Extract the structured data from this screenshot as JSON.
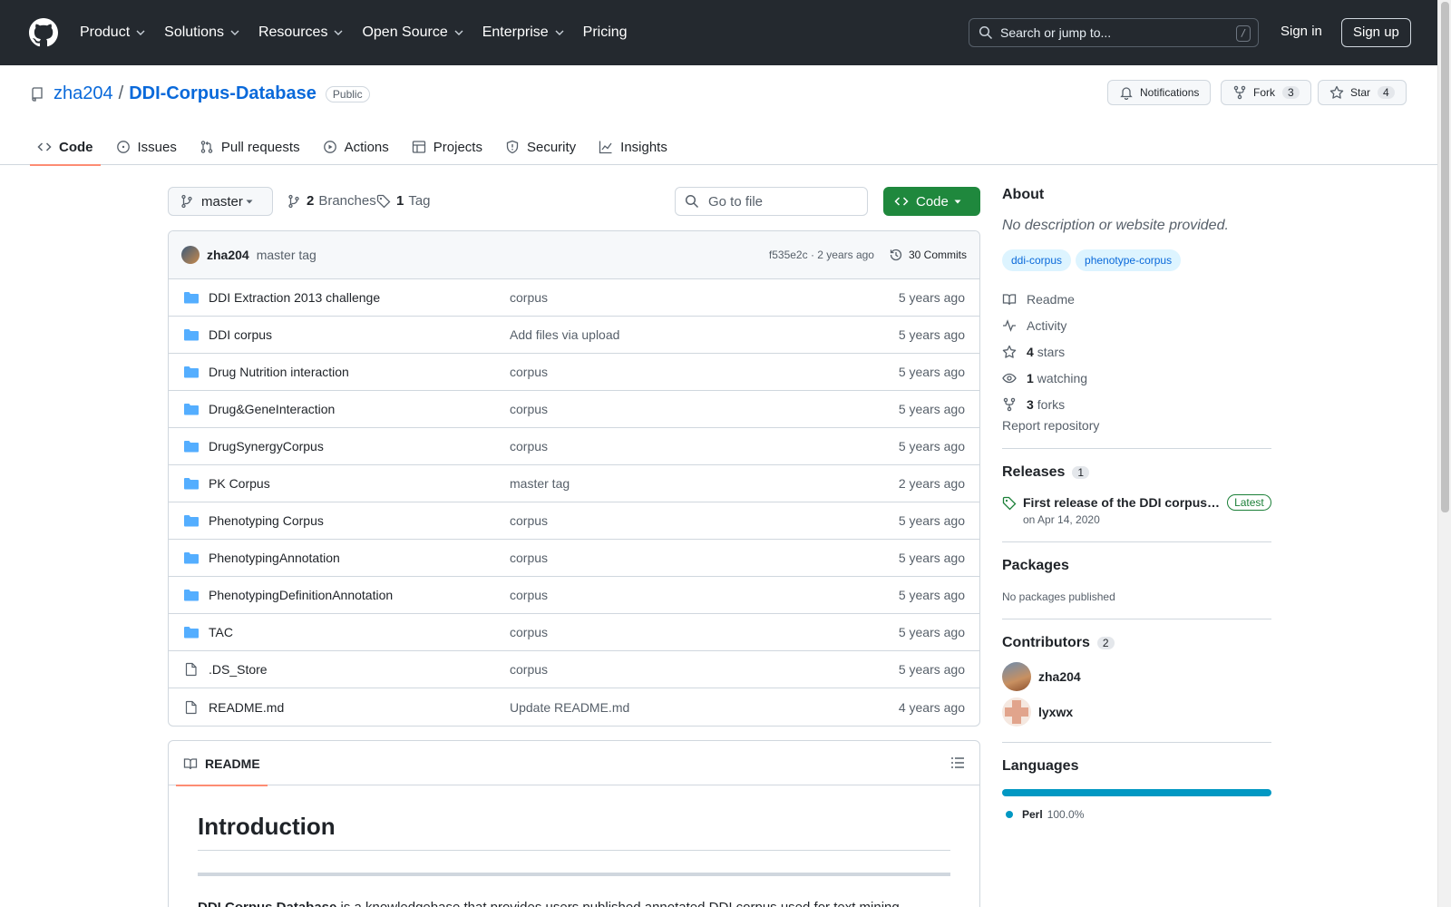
{
  "header": {
    "nav": [
      {
        "label": "Product",
        "dropdown": true
      },
      {
        "label": "Solutions",
        "dropdown": true
      },
      {
        "label": "Resources",
        "dropdown": true
      },
      {
        "label": "Open Source",
        "dropdown": true
      },
      {
        "label": "Enterprise",
        "dropdown": true
      },
      {
        "label": "Pricing",
        "dropdown": false
      }
    ],
    "search_placeholder": "Search or jump to...",
    "search_shortcut": "/",
    "sign_in": "Sign in",
    "sign_up": "Sign up"
  },
  "repo": {
    "owner": "zha204",
    "separator": "/",
    "name": "DDI-Corpus-Database",
    "visibility": "Public",
    "notifications_label": "Notifications",
    "fork_label": "Fork",
    "fork_count": "3",
    "star_label": "Star",
    "star_count": "4",
    "tabs": [
      {
        "label": "Code",
        "icon": "code-icon",
        "active": true
      },
      {
        "label": "Issues",
        "icon": "issue-icon",
        "active": false
      },
      {
        "label": "Pull requests",
        "icon": "pull-request-icon",
        "active": false
      },
      {
        "label": "Actions",
        "icon": "play-icon",
        "active": false
      },
      {
        "label": "Projects",
        "icon": "table-icon",
        "active": false
      },
      {
        "label": "Security",
        "icon": "shield-icon",
        "active": false
      },
      {
        "label": "Insights",
        "icon": "graph-icon",
        "active": false
      }
    ]
  },
  "toolbar": {
    "branch": "master",
    "branches_count": "2",
    "branches_label": "Branches",
    "tags_count": "1",
    "tags_label": "Tag",
    "goto_file": "Go to file",
    "code_button": "Code"
  },
  "latest_commit": {
    "user": "zha204",
    "message": "master tag",
    "hash_and_time": "f535e2c · 2 years ago",
    "commits_label": "30 Commits"
  },
  "files": [
    {
      "name": "DDI Extraction 2013 challenge",
      "type": "folder",
      "message": "corpus",
      "date": "5 years ago"
    },
    {
      "name": "DDI corpus",
      "type": "folder",
      "message": "Add files via upload",
      "date": "5 years ago"
    },
    {
      "name": "Drug Nutrition interaction",
      "type": "folder",
      "message": "corpus",
      "date": "5 years ago"
    },
    {
      "name": "Drug&GeneInteraction",
      "type": "folder",
      "message": "corpus",
      "date": "5 years ago"
    },
    {
      "name": "DrugSynergyCorpus",
      "type": "folder",
      "message": "corpus",
      "date": "5 years ago"
    },
    {
      "name": "PK Corpus",
      "type": "folder",
      "message": "master tag",
      "date": "2 years ago"
    },
    {
      "name": "Phenotyping Corpus",
      "type": "folder",
      "message": "corpus",
      "date": "5 years ago"
    },
    {
      "name": "PhenotypingAnnotation",
      "type": "folder",
      "message": "corpus",
      "date": "5 years ago"
    },
    {
      "name": "PhenotypingDefinitionAnnotation",
      "type": "folder",
      "message": "corpus",
      "date": "5 years ago"
    },
    {
      "name": "TAC",
      "type": "folder",
      "message": "corpus",
      "date": "5 years ago"
    },
    {
      "name": ".DS_Store",
      "type": "file",
      "message": "corpus",
      "date": "5 years ago"
    },
    {
      "name": "README.md",
      "type": "file",
      "message": "Update README.md",
      "date": "4 years ago"
    }
  ],
  "readme": {
    "tab_label": "README",
    "heading": "Introduction",
    "paragraph_bold": "DDI Corpus Database",
    "paragraph_rest": " is a knowledgebase that provides users published annotated DDI corpus used for text mining."
  },
  "about": {
    "title": "About",
    "description": "No description or website provided.",
    "topics": [
      "ddi-corpus",
      "phenotype-corpus"
    ],
    "readme": "Readme",
    "activity": "Activity",
    "stars_count": "4",
    "stars_label": "stars",
    "watching_count": "1",
    "watching_label": "watching",
    "forks_count": "3",
    "forks_label": "forks",
    "report": "Report repository"
  },
  "releases": {
    "title": "Releases",
    "count": "1",
    "name": "First release of the DDI corpus…",
    "badge": "Latest",
    "date": "on Apr 14, 2020"
  },
  "packages": {
    "title": "Packages",
    "empty": "No packages published"
  },
  "contributors": {
    "title": "Contributors",
    "count": "2",
    "list": [
      "zha204",
      "lyxwx"
    ]
  },
  "languages": {
    "title": "Languages",
    "items": [
      {
        "name": "Perl",
        "percent": "100.0%",
        "color": "#0298c3"
      }
    ]
  }
}
